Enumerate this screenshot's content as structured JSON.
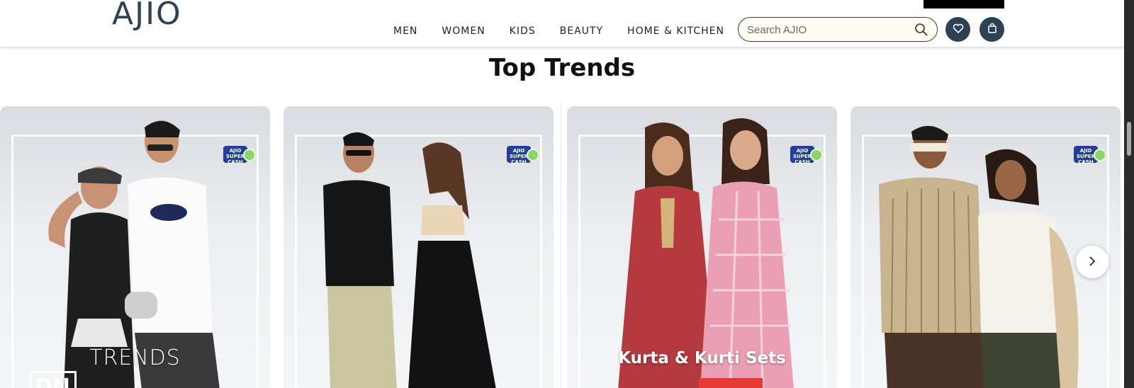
{
  "header": {
    "logo_text": "AJIO",
    "nav": [
      "MEN",
      "WOMEN",
      "KIDS",
      "BEAUTY",
      "HOME & KITCHEN"
    ],
    "search": {
      "placeholder": "Search AJIO",
      "icon": "search-icon"
    },
    "wishlist_icon": "heart-icon",
    "bag_icon": "shopping-bag-icon"
  },
  "section": {
    "title": "Top Trends"
  },
  "cards": [
    {
      "label": "TRENDS",
      "badge": "AJIO SUPER CASH",
      "logo_text": "DN"
    },
    {
      "label": "",
      "badge": "AJIO SUPER CASH"
    },
    {
      "label": "Kurta & Kurti Sets",
      "badge": "AJIO SUPER CASH"
    },
    {
      "label": "",
      "badge": "AJIO SUPER CASH"
    }
  ],
  "carousel": {
    "next_icon": "chevron-right-icon"
  },
  "colors": {
    "brand": "#2c4152",
    "search_bg": "#fffdf1",
    "badge": "#233f95"
  }
}
